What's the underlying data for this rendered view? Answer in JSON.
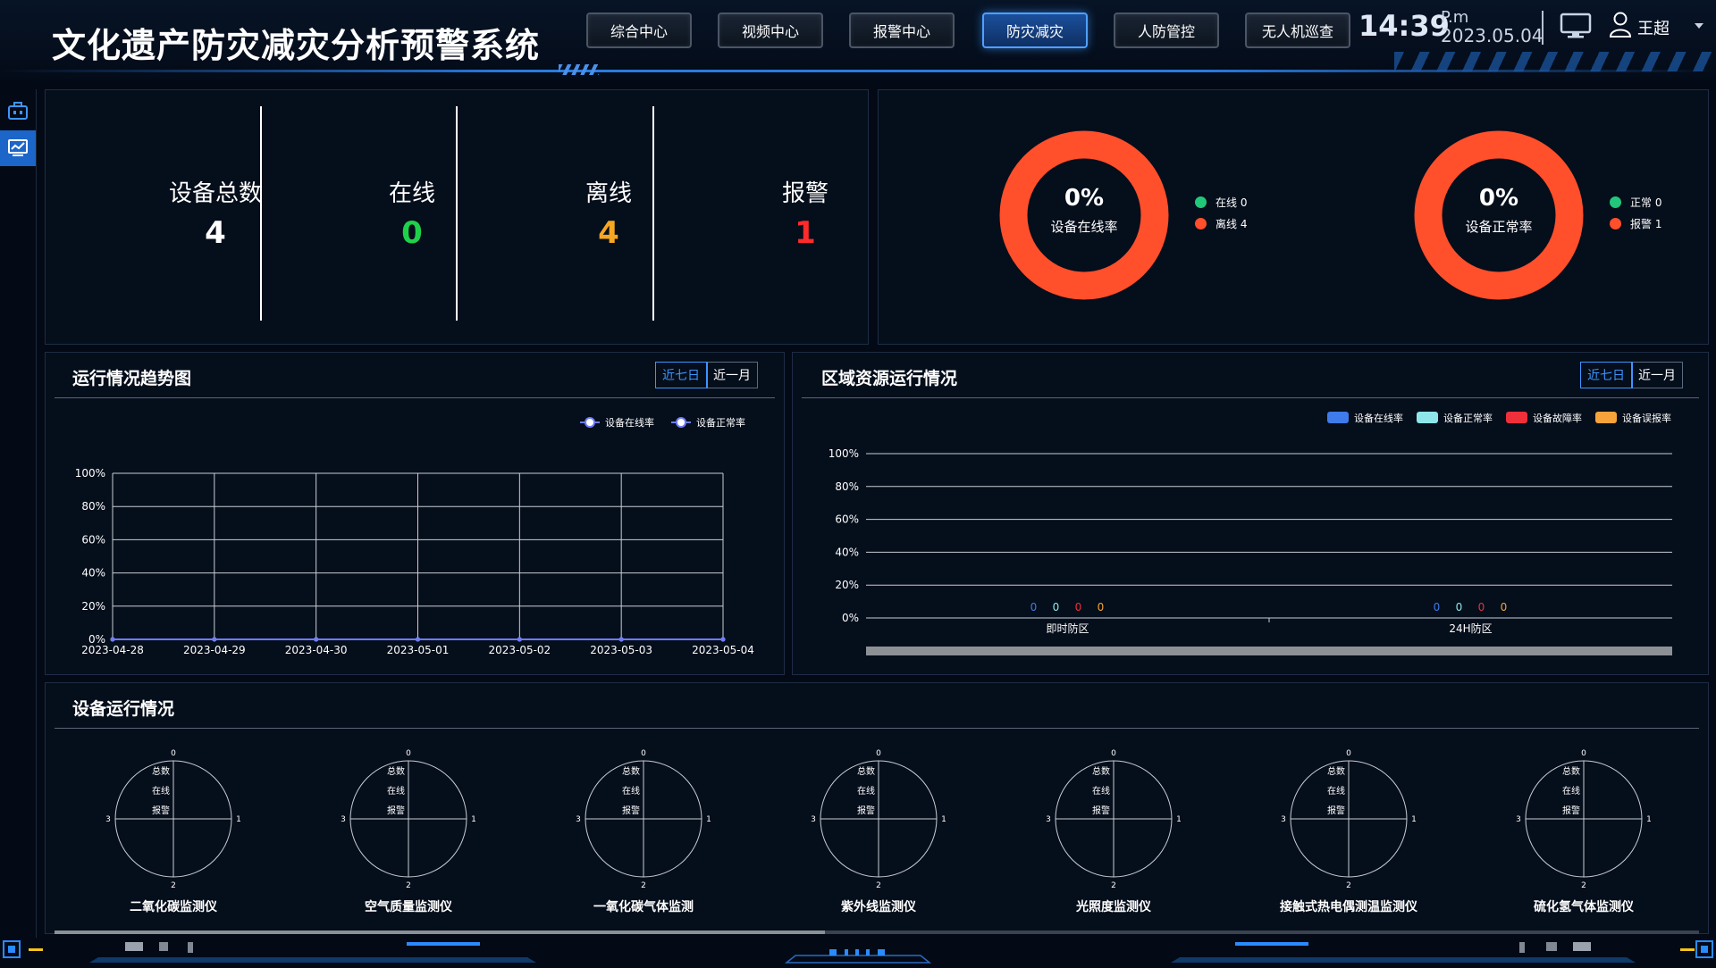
{
  "header": {
    "title": "文化遗产防灾减灾分析预警系统",
    "nav": [
      {
        "label": "综合中心",
        "active": false
      },
      {
        "label": "视频中心",
        "active": false
      },
      {
        "label": "报警中心",
        "active": false
      },
      {
        "label": "防灾减灾",
        "active": true
      },
      {
        "label": "人防管控",
        "active": false
      },
      {
        "label": "无人机巡查",
        "active": false
      }
    ],
    "time": "14:39",
    "ampm": "P.m",
    "date": "2023.05.04",
    "user": "王超",
    "accent_color": "#4fa0ff"
  },
  "sidebar": {
    "items": [
      {
        "icon": "toolbox-icon",
        "active": false
      },
      {
        "icon": "monitor-chart-icon",
        "active": true
      }
    ]
  },
  "stats": [
    {
      "label": "设备总数",
      "value": "4",
      "color": "#ffffff"
    },
    {
      "label": "在线",
      "value": "0",
      "color": "#1fd14a"
    },
    {
      "label": "离线",
      "value": "4",
      "color": "#f5a623"
    },
    {
      "label": "报警",
      "value": "1",
      "color": "#ff2b2b"
    }
  ],
  "donuts": [
    {
      "pct": "0%",
      "label": "设备在线率",
      "legend": [
        {
          "text": "在线 0",
          "color": "#22c77a"
        },
        {
          "text": "离线 4",
          "color": "#ff4f2b"
        }
      ]
    },
    {
      "pct": "0%",
      "label": "设备正常率",
      "legend": [
        {
          "text": "正常 0",
          "color": "#22c77a"
        },
        {
          "text": "报警 1",
          "color": "#ff4f2b"
        }
      ]
    }
  ],
  "trend_panel": {
    "title": "运行情况趋势图",
    "tabs": [
      "近七日",
      "近一月"
    ],
    "active_tab": "近七日"
  },
  "region_panel": {
    "title": "区域资源运行情况",
    "tabs": [
      "近七日",
      "近一月"
    ],
    "active_tab": "近七日"
  },
  "device_panel": {
    "title": "设备运行情况",
    "gauge_labels": [
      "总数",
      "在线",
      "报警"
    ],
    "devices": [
      "二氧化碳监测仪",
      "空气质量监测仪",
      "一氧化碳气体监测",
      "紫外线监测仪",
      "光照度监测仪",
      "接触式热电偶测温监测仪",
      "硫化氢气体监测仪"
    ],
    "axis_ticks": [
      "0",
      "1",
      "2",
      "3"
    ]
  },
  "chart_data": [
    {
      "type": "line",
      "x": [
        "2023-04-28",
        "2023-04-29",
        "2023-04-30",
        "2023-05-01",
        "2023-05-02",
        "2023-05-03",
        "2023-05-04"
      ],
      "series": [
        {
          "name": "设备在线率",
          "values": [
            0,
            0,
            0,
            0,
            0,
            0,
            0
          ],
          "color": "#ffffff"
        },
        {
          "name": "设备正常率",
          "values": [
            0,
            0,
            0,
            0,
            0,
            0,
            0
          ],
          "color": "#6f7cff"
        }
      ],
      "y_ticks": [
        "0%",
        "20%",
        "40%",
        "60%",
        "80%",
        "100%"
      ],
      "ylim": [
        0,
        100
      ],
      "grid": true,
      "legend": "top-right"
    },
    {
      "type": "bar",
      "categories": [
        "即时防区",
        "24H防区"
      ],
      "series": [
        {
          "name": "设备在线率",
          "values": [
            0,
            0
          ],
          "color": "#3f7bea"
        },
        {
          "name": "设备正常率",
          "values": [
            0,
            0
          ],
          "color": "#8ee6ea"
        },
        {
          "name": "设备故障率",
          "values": [
            0,
            0
          ],
          "color": "#ef2f3a"
        },
        {
          "name": "设备误报率",
          "values": [
            0,
            0
          ],
          "color": "#f5a33a"
        }
      ],
      "y_ticks": [
        "0%",
        "20%",
        "40%",
        "60%",
        "80%",
        "100%"
      ],
      "ylim": [
        0,
        100
      ],
      "grid": true,
      "legend": "top-right"
    }
  ]
}
